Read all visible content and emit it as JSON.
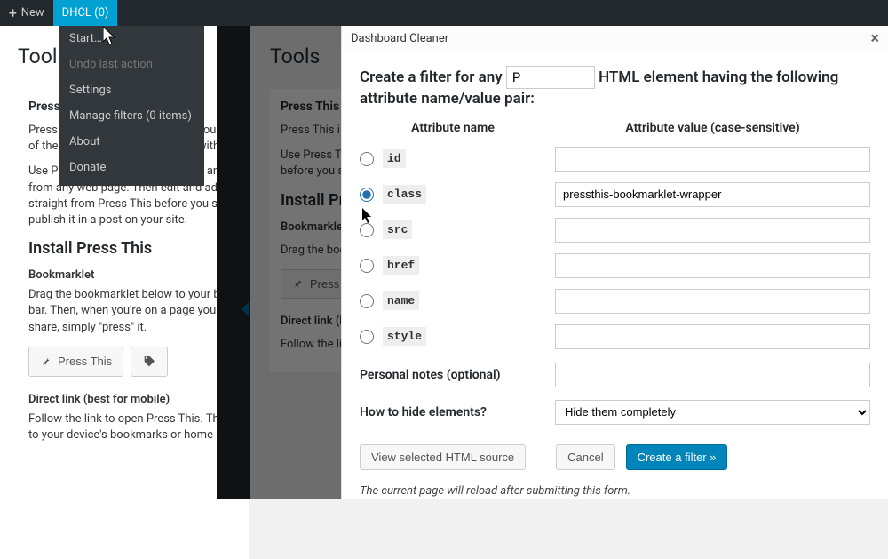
{
  "adminbar": {
    "new": "New",
    "dhcl": "DHCL (0)"
  },
  "dropdown": {
    "start": "Start…",
    "undo": "Undo last action",
    "settings": "Settings",
    "manage": "Manage filters (0 items)",
    "about": "About",
    "donate": "Donate"
  },
  "page": {
    "title": "Tools",
    "press_heading": "Press This",
    "press_p1": "Press This is a little tool that lets you grab bits of the web and create new posts with ease.",
    "press_p2": "Use Press This to clip text, images and videos from any web page. Then edit and add more straight from Press This before you save or publish it in a post on your site.",
    "install_heading": "Install Press This",
    "bookmarklet_label": "Bookmarklet",
    "bookmarklet_text": "Drag the bookmarklet below to your bookmarks bar. Then, when you're on a page you want to share, simply \"press\" it.",
    "press_btn": "Press This",
    "direct_label": "Direct link (best for mobile)",
    "direct_text": "Follow the link to open Press This. Then add it to your device's bookmarks or home screen."
  },
  "modal": {
    "title": "Dashboard Cleaner",
    "lead_before": "Create a filter for any ",
    "element_value": "P",
    "lead_after": " HTML element having the following attribute name/value pair:",
    "col_name": "Attribute name",
    "col_value": "Attribute value (case-sensitive)",
    "attrs": {
      "id": "id",
      "class": "class",
      "src": "src",
      "href": "href",
      "name": "name",
      "style": "style"
    },
    "class_value": "pressthis-bookmarklet-wrapper",
    "notes_label": "Personal notes (optional)",
    "hide_label": "How to hide elements?",
    "hide_selected": "Hide them completely",
    "btn_view": "View selected HTML source",
    "btn_cancel": "Cancel",
    "btn_create": "Create a filter »",
    "footnote": "The current page will reload after submitting this form."
  }
}
